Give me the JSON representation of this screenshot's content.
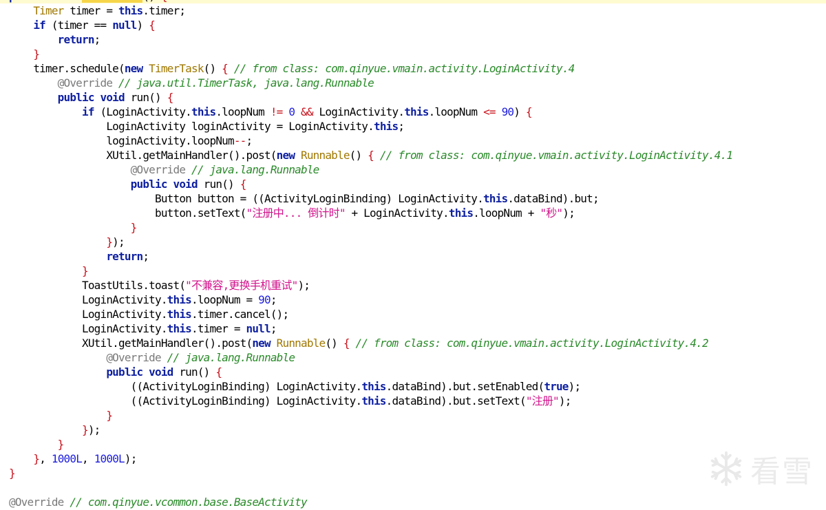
{
  "editor": {
    "lines": [
      [
        [
          "kw",
          "public "
        ],
        [
          "kw",
          "void "
        ],
        [
          "hl",
          "startTimer"
        ],
        [
          "plain",
          "() "
        ],
        [
          "brace",
          "{"
        ]
      ],
      [
        [
          "plain",
          "    "
        ],
        [
          "type",
          "Timer"
        ],
        [
          "plain",
          " timer = "
        ],
        [
          "kw",
          "this"
        ],
        [
          "plain",
          ".timer;"
        ]
      ],
      [
        [
          "plain",
          "    "
        ],
        [
          "kw",
          "if"
        ],
        [
          "plain",
          " (timer == "
        ],
        [
          "kw",
          "null"
        ],
        [
          "plain",
          ") "
        ],
        [
          "brace",
          "{"
        ]
      ],
      [
        [
          "plain",
          "        "
        ],
        [
          "kw",
          "return"
        ],
        [
          "plain",
          ";"
        ]
      ],
      [
        [
          "plain",
          "    "
        ],
        [
          "brace",
          "}"
        ]
      ],
      [
        [
          "plain",
          "    timer.schedule("
        ],
        [
          "kw",
          "new "
        ],
        [
          "type",
          "TimerTask"
        ],
        [
          "plain",
          "() "
        ],
        [
          "brace",
          "{ "
        ],
        [
          "comment",
          "// from class: com.qinyue.vmain.activity.LoginActivity.4"
        ]
      ],
      [
        [
          "plain",
          "        "
        ],
        [
          "ann",
          "@Override "
        ],
        [
          "comment",
          "// java.util.TimerTask, java.lang.Runnable"
        ]
      ],
      [
        [
          "plain",
          "        "
        ],
        [
          "kw",
          "public "
        ],
        [
          "kw",
          "void"
        ],
        [
          "plain",
          " run() "
        ],
        [
          "brace",
          "{"
        ]
      ],
      [
        [
          "plain",
          "            "
        ],
        [
          "kw",
          "if"
        ],
        [
          "plain",
          " (LoginActivity."
        ],
        [
          "kw",
          "this"
        ],
        [
          "plain",
          ".loopNum "
        ],
        [
          "red",
          "!="
        ],
        [
          "plain",
          " "
        ],
        [
          "num",
          "0"
        ],
        [
          "plain",
          " "
        ],
        [
          "red",
          "&&"
        ],
        [
          "plain",
          " LoginActivity."
        ],
        [
          "kw",
          "this"
        ],
        [
          "plain",
          ".loopNum "
        ],
        [
          "red",
          "<="
        ],
        [
          "plain",
          " "
        ],
        [
          "num",
          "90"
        ],
        [
          "plain",
          ") "
        ],
        [
          "brace",
          "{"
        ]
      ],
      [
        [
          "plain",
          "                LoginActivity loginActivity = LoginActivity."
        ],
        [
          "kw",
          "this"
        ],
        [
          "plain",
          ";"
        ]
      ],
      [
        [
          "plain",
          "                loginActivity.loopNum"
        ],
        [
          "red",
          "--"
        ],
        [
          "plain",
          ";"
        ]
      ],
      [
        [
          "plain",
          "                XUtil.getMainHandler().post("
        ],
        [
          "kw",
          "new "
        ],
        [
          "type",
          "Runnable"
        ],
        [
          "plain",
          "() "
        ],
        [
          "brace",
          "{ "
        ],
        [
          "comment",
          "// from class: com.qinyue.vmain.activity.LoginActivity.4.1"
        ]
      ],
      [
        [
          "plain",
          "                    "
        ],
        [
          "ann",
          "@Override "
        ],
        [
          "comment",
          "// java.lang.Runnable"
        ]
      ],
      [
        [
          "plain",
          "                    "
        ],
        [
          "kw",
          "public "
        ],
        [
          "kw",
          "void"
        ],
        [
          "plain",
          " run() "
        ],
        [
          "brace",
          "{"
        ]
      ],
      [
        [
          "plain",
          "                        Button button = ((ActivityLoginBinding) LoginActivity."
        ],
        [
          "kw",
          "this"
        ],
        [
          "plain",
          ".dataBind).but;"
        ]
      ],
      [
        [
          "plain",
          "                        button.setText("
        ],
        [
          "str",
          "\"注册中... 倒计时\""
        ],
        [
          "plain",
          " + LoginActivity."
        ],
        [
          "kw",
          "this"
        ],
        [
          "plain",
          ".loopNum + "
        ],
        [
          "str",
          "\"秒\""
        ],
        [
          "plain",
          ");"
        ]
      ],
      [
        [
          "plain",
          "                    "
        ],
        [
          "brace",
          "}"
        ]
      ],
      [
        [
          "plain",
          "                "
        ],
        [
          "brace",
          "}"
        ],
        [
          "plain",
          ");"
        ]
      ],
      [
        [
          "plain",
          "                "
        ],
        [
          "kw",
          "return"
        ],
        [
          "plain",
          ";"
        ]
      ],
      [
        [
          "plain",
          "            "
        ],
        [
          "brace",
          "}"
        ]
      ],
      [
        [
          "plain",
          "            ToastUtils.toast("
        ],
        [
          "str",
          "\"不兼容,更换手机重试\""
        ],
        [
          "plain",
          ");"
        ]
      ],
      [
        [
          "plain",
          "            LoginActivity."
        ],
        [
          "kw",
          "this"
        ],
        [
          "plain",
          ".loopNum = "
        ],
        [
          "num",
          "90"
        ],
        [
          "plain",
          ";"
        ]
      ],
      [
        [
          "plain",
          "            LoginActivity."
        ],
        [
          "kw",
          "this"
        ],
        [
          "plain",
          ".timer.cancel();"
        ]
      ],
      [
        [
          "plain",
          "            LoginActivity."
        ],
        [
          "kw",
          "this"
        ],
        [
          "plain",
          ".timer = "
        ],
        [
          "kw",
          "null"
        ],
        [
          "plain",
          ";"
        ]
      ],
      [
        [
          "plain",
          "            XUtil.getMainHandler().post("
        ],
        [
          "kw",
          "new "
        ],
        [
          "type",
          "Runnable"
        ],
        [
          "plain",
          "() "
        ],
        [
          "brace",
          "{ "
        ],
        [
          "comment",
          "// from class: com.qinyue.vmain.activity.LoginActivity.4.2"
        ]
      ],
      [
        [
          "plain",
          "                "
        ],
        [
          "ann",
          "@Override "
        ],
        [
          "comment",
          "// java.lang.Runnable"
        ]
      ],
      [
        [
          "plain",
          "                "
        ],
        [
          "kw",
          "public "
        ],
        [
          "kw",
          "void"
        ],
        [
          "plain",
          " run() "
        ],
        [
          "brace",
          "{"
        ]
      ],
      [
        [
          "plain",
          "                    ((ActivityLoginBinding) LoginActivity."
        ],
        [
          "kw",
          "this"
        ],
        [
          "plain",
          ".dataBind).but.setEnabled("
        ],
        [
          "kw",
          "true"
        ],
        [
          "plain",
          ");"
        ]
      ],
      [
        [
          "plain",
          "                    ((ActivityLoginBinding) LoginActivity."
        ],
        [
          "kw",
          "this"
        ],
        [
          "plain",
          ".dataBind).but.setText("
        ],
        [
          "str",
          "\"注册\""
        ],
        [
          "plain",
          ");"
        ]
      ],
      [
        [
          "plain",
          "                "
        ],
        [
          "brace",
          "}"
        ]
      ],
      [
        [
          "plain",
          "            "
        ],
        [
          "brace",
          "}"
        ],
        [
          "plain",
          ");"
        ]
      ],
      [
        [
          "plain",
          "        "
        ],
        [
          "brace",
          "}"
        ]
      ],
      [
        [
          "plain",
          "    "
        ],
        [
          "brace",
          "}"
        ],
        [
          "plain",
          ", "
        ],
        [
          "num",
          "1000L"
        ],
        [
          "plain",
          ", "
        ],
        [
          "num",
          "1000L"
        ],
        [
          "plain",
          ");"
        ]
      ],
      [
        [
          "brace",
          "}"
        ]
      ],
      [
        [
          "plain",
          ""
        ]
      ],
      [
        [
          "ann",
          "@Override "
        ],
        [
          "comment",
          "// com.qinyue.vcommon.base.BaseActivity"
        ]
      ]
    ],
    "current_line_index": 0
  },
  "watermark": {
    "text": "看雪",
    "icon": "snowflake-logo-icon"
  },
  "colors": {
    "keyword": "#0d1fa0",
    "type": "#a07800",
    "string": "#d1148c",
    "number": "#1d1ddb",
    "comment": "#2a8a2a",
    "annotation": "#7a7a7a",
    "operator": "#c8101a",
    "highlight": "#f7d54a",
    "current_line": "#fffbd0"
  }
}
